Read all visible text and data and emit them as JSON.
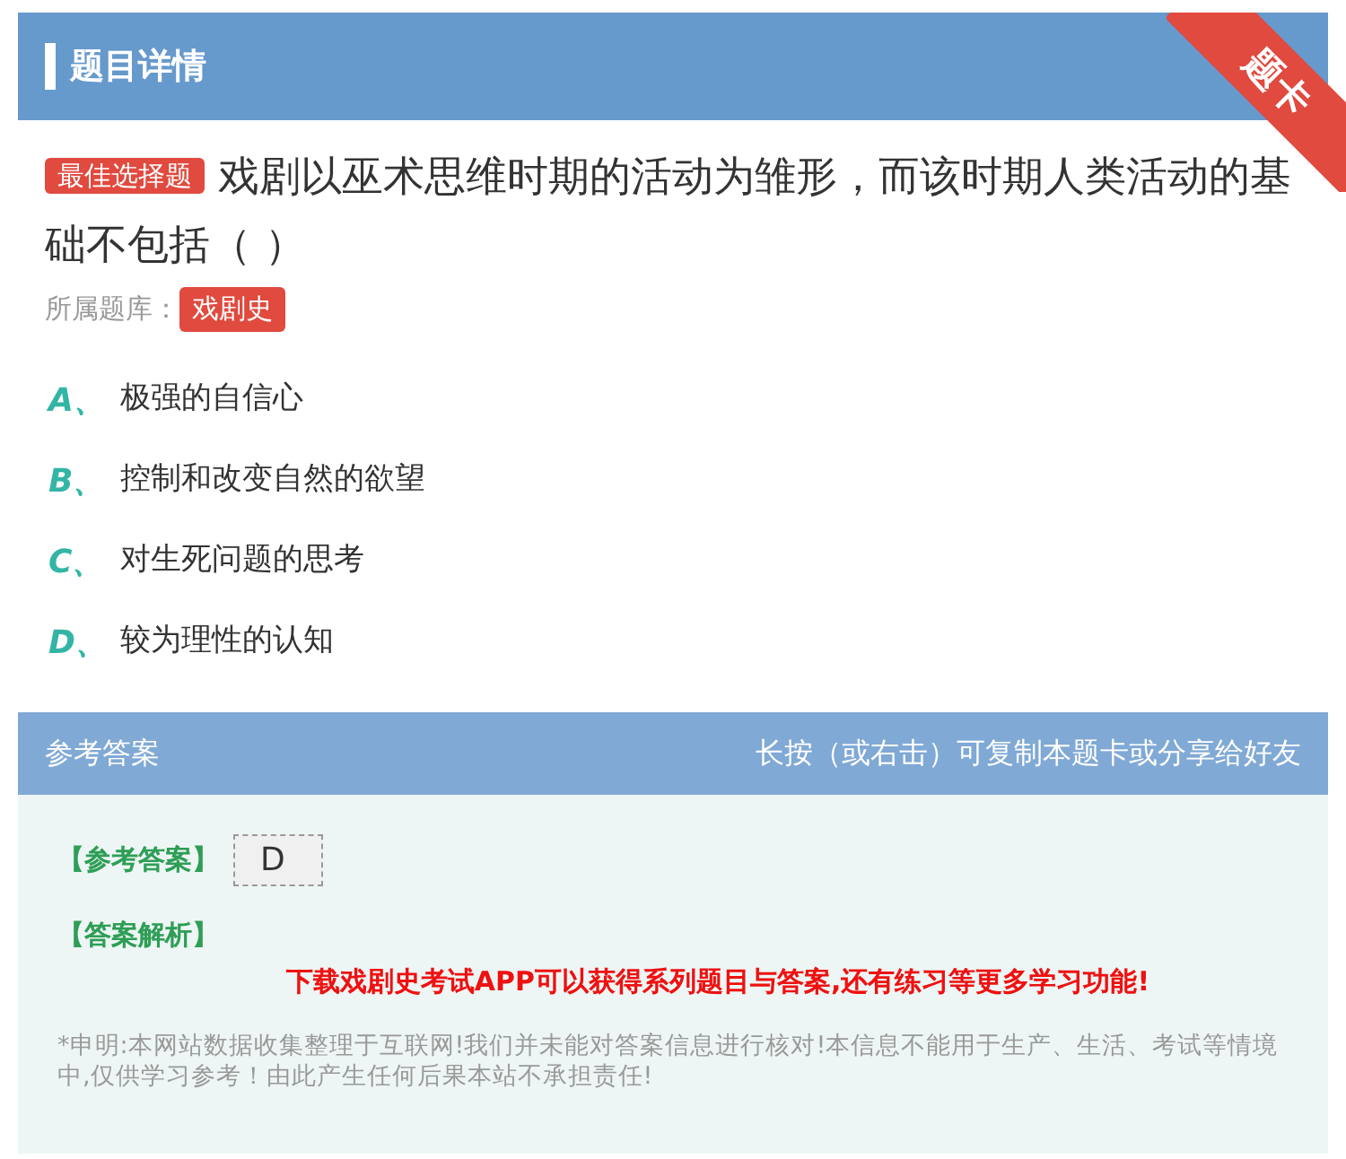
{
  "header": {
    "title": "题目详情",
    "ribbon": "题卡"
  },
  "question": {
    "type_tag": "最佳选择题",
    "text": "戏剧以巫术思维时期的活动为雏形，而该时期人类活动的基础不包括（ ）",
    "bank_label": "所属题库：",
    "bank_tag": "戏剧史"
  },
  "options": [
    {
      "letter": "A、",
      "text": "极强的自信心"
    },
    {
      "letter": "B、",
      "text": "控制和改变自然的欲望"
    },
    {
      "letter": "C、",
      "text": "对生死问题的思考"
    },
    {
      "letter": "D、",
      "text": "较为理性的认知"
    }
  ],
  "answer_header": {
    "title": "参考答案",
    "hint": "长按（或右击）可复制本题卡或分享给好友"
  },
  "answer": {
    "answer_label": "【参考答案】",
    "answer_value": "D",
    "analysis_label": "【答案解析】",
    "promo": "下载戏剧史考试APP可以获得系列题目与答案,还有练习等更多学习功能!",
    "disclaimer": "*申明:本网站数据收集整理于互联网!我们并未能对答案信息进行核对!本信息不能用于生产、生活、考试等情境中,仅供学习参考！由此产生任何后果本站不承担责任!"
  }
}
